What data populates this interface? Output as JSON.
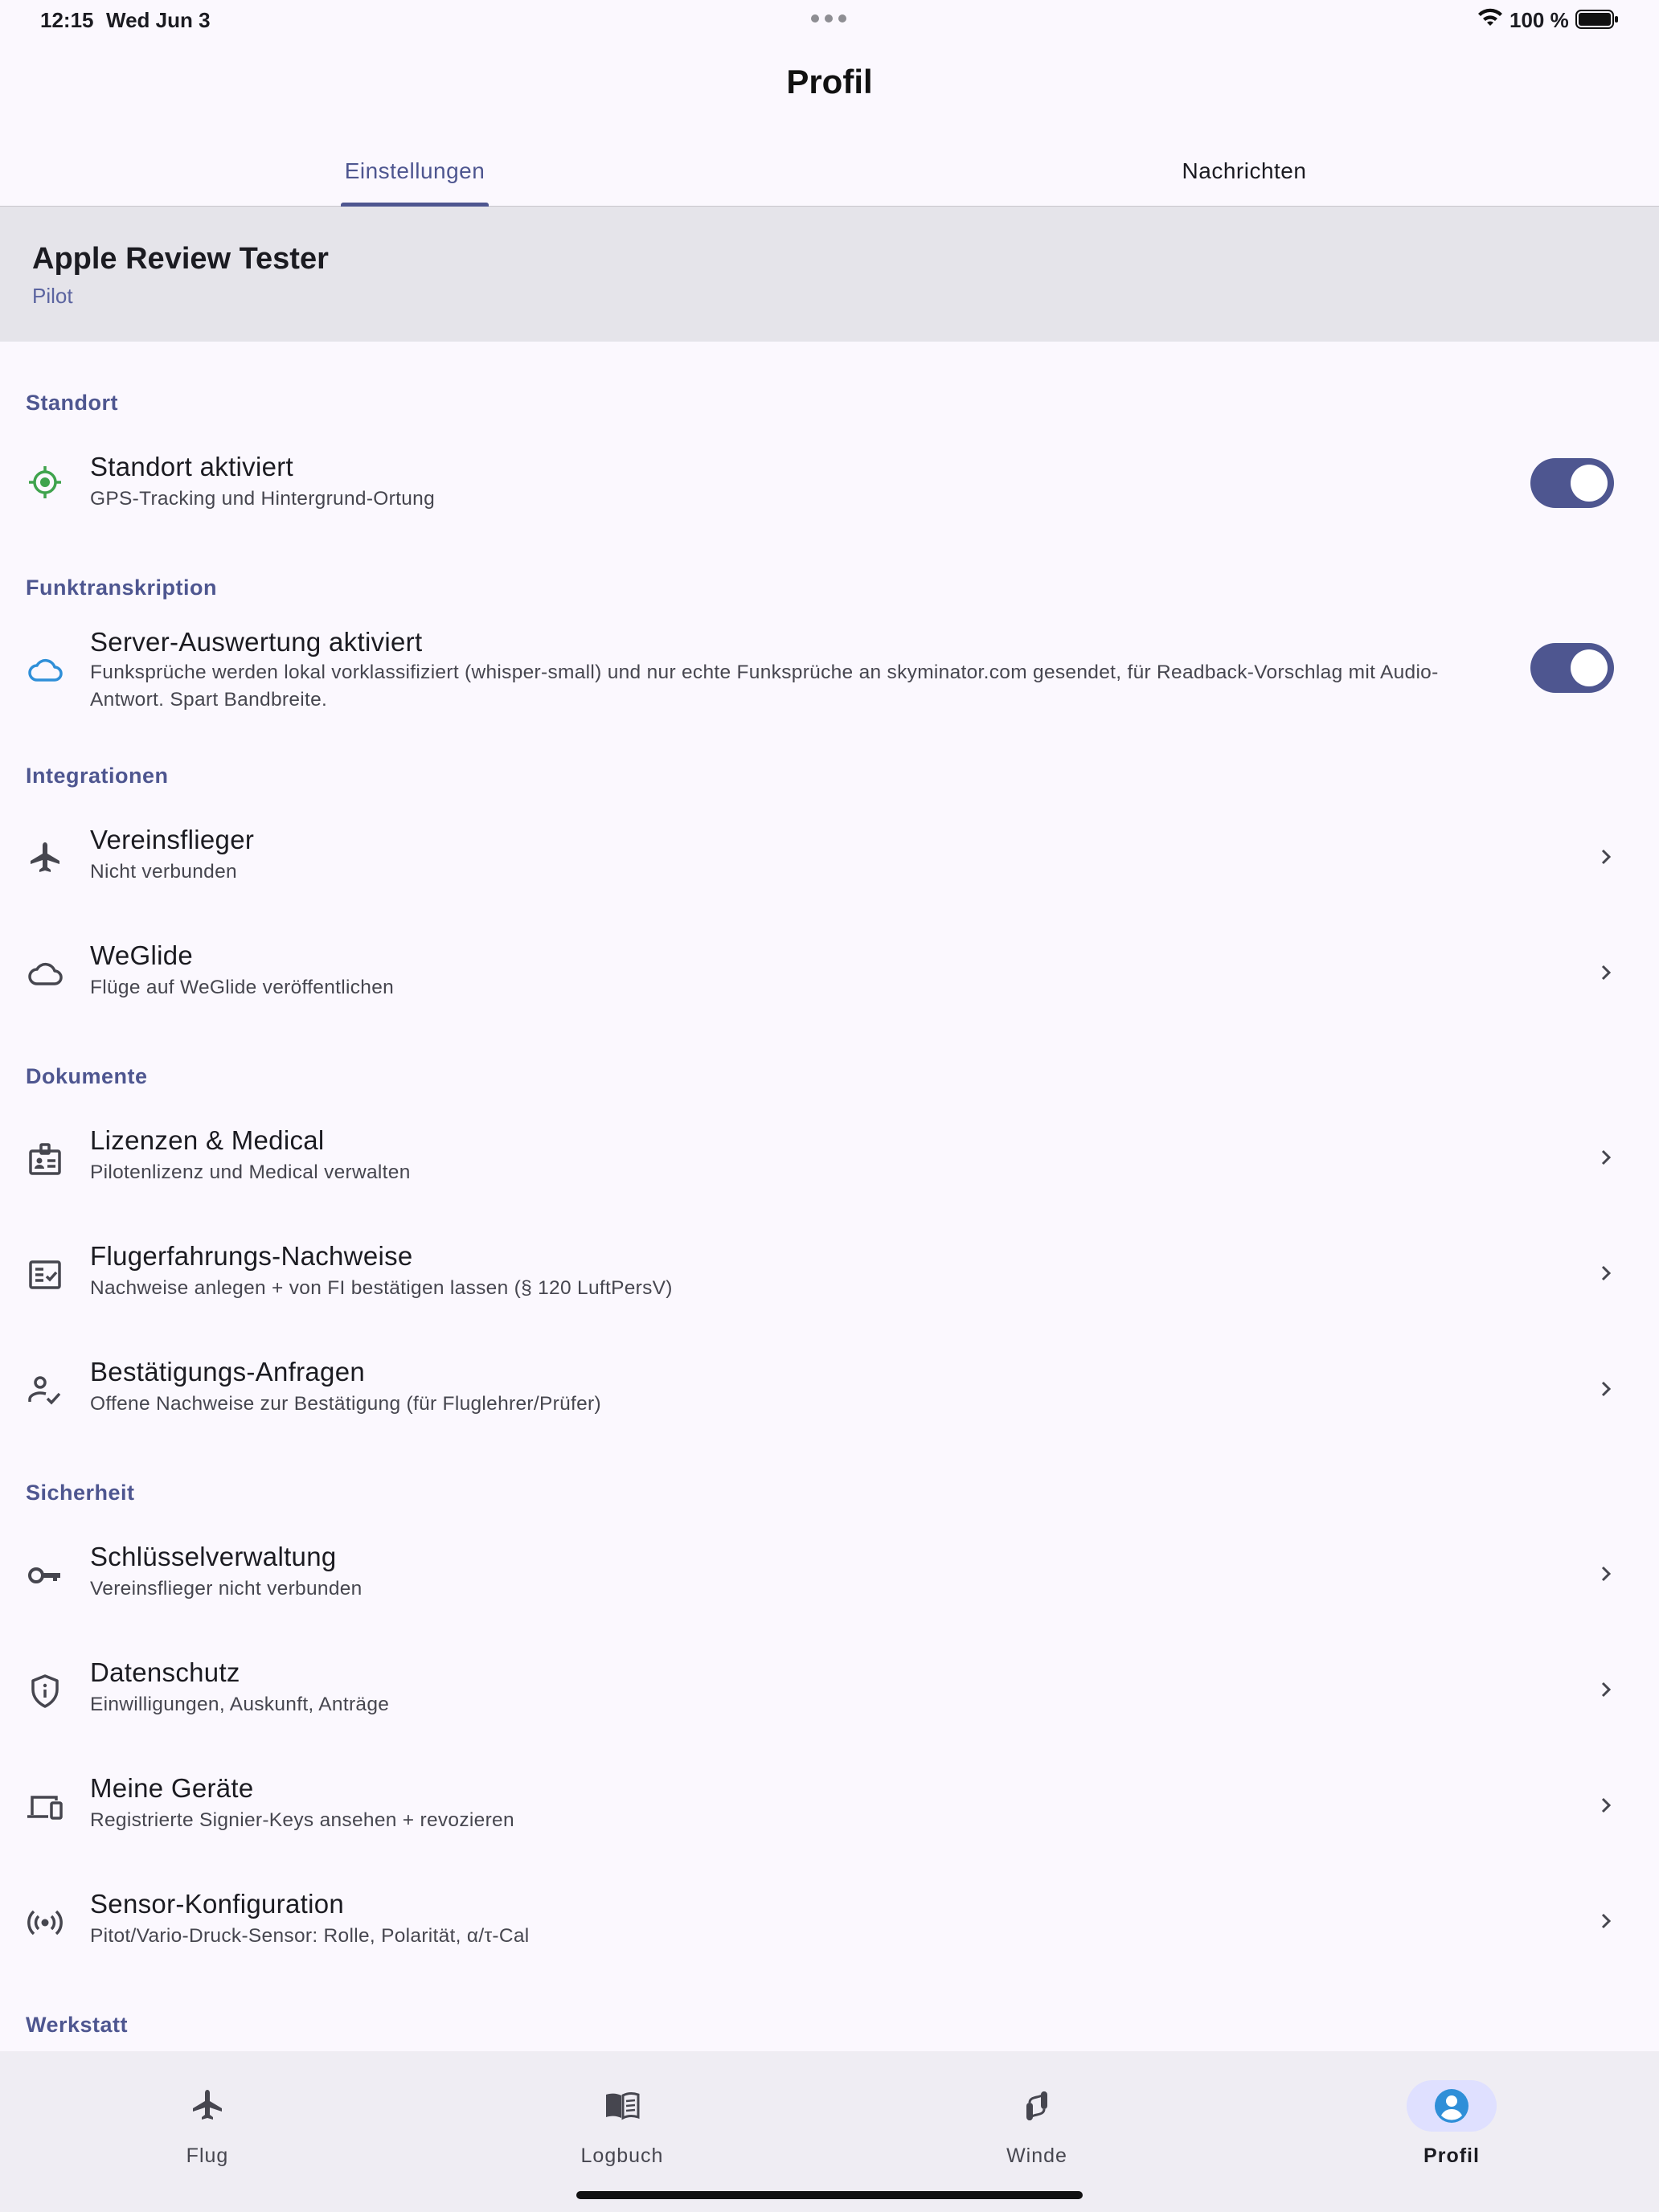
{
  "status_bar": {
    "time": "12:15",
    "date": "Wed Jun 3",
    "battery": "100 %"
  },
  "header": {
    "title": "Profil"
  },
  "tabs": [
    {
      "label": "Einstellungen",
      "active": true
    },
    {
      "label": "Nachrichten",
      "active": false
    }
  ],
  "profile": {
    "name": "Apple Review Tester",
    "role": "Pilot"
  },
  "sections": {
    "standort": "Standort",
    "funk": "Funktranskription",
    "integrationen": "Integrationen",
    "dokumente": "Dokumente",
    "sicherheit": "Sicherheit",
    "werkstatt": "Werkstatt"
  },
  "rows": {
    "standort": {
      "title": "Standort aktiviert",
      "subtitle": "GPS-Tracking und Hintergrund-Ortung",
      "enabled": true,
      "icon": "gps-fixed-icon"
    },
    "server": {
      "title": "Server-Auswertung aktiviert",
      "subtitle": "Funksprüche werden lokal vorklassifiziert (whisper-small) und nur echte Funksprüche an skyminator.com gesendet, für Readback-Vorschlag mit Audio-Antwort. Spart Bandbreite.",
      "enabled": true,
      "icon": "cloud-icon"
    },
    "vereinsflieger": {
      "title": "Vereinsflieger",
      "subtitle": "Nicht verbunden",
      "icon": "airplane-icon"
    },
    "weglide": {
      "title": "WeGlide",
      "subtitle": "Flüge auf WeGlide veröffentlichen",
      "icon": "cloud-outline-icon"
    },
    "lizenzen": {
      "title": "Lizenzen & Medical",
      "subtitle": "Pilotenlizenz und Medical verwalten",
      "icon": "badge-icon"
    },
    "nachweise": {
      "title": "Flugerfahrungs-Nachweise",
      "subtitle": "Nachweise anlegen + von FI bestätigen lassen (§ 120 LuftPersV)",
      "icon": "checklist-icon"
    },
    "anfragen": {
      "title": "Bestätigungs-Anfragen",
      "subtitle": "Offene Nachweise zur Bestätigung (für Fluglehrer/Prüfer)",
      "icon": "person-check-icon"
    },
    "schluessel": {
      "title": "Schlüsselverwaltung",
      "subtitle": "Vereinsflieger nicht verbunden",
      "icon": "key-icon"
    },
    "datenschutz": {
      "title": "Datenschutz",
      "subtitle": "Einwilligungen, Auskunft, Anträge",
      "icon": "shield-info-icon"
    },
    "geraete": {
      "title": "Meine Geräte",
      "subtitle": "Registrierte Signier-Keys ansehen + revozieren",
      "icon": "devices-icon"
    },
    "sensor": {
      "title": "Sensor-Konfiguration",
      "subtitle": "Pitot/Vario-Druck-Sensor: Rolle, Polarität, α/τ-Cal",
      "icon": "sensors-icon"
    }
  },
  "bottom_nav": [
    {
      "label": "Flug",
      "icon": "airplane-icon",
      "active": false
    },
    {
      "label": "Logbuch",
      "icon": "book-icon",
      "active": false
    },
    {
      "label": "Winde",
      "icon": "winch-icon",
      "active": false
    },
    {
      "label": "Profil",
      "icon": "account-circle-icon",
      "active": true
    }
  ],
  "colors": {
    "accent": "#4e5690",
    "background": "#fbf8fe",
    "location_green": "#3fa34d",
    "cloud_blue": "#2f8fd8",
    "profile_blue": "#2f8fd8"
  }
}
